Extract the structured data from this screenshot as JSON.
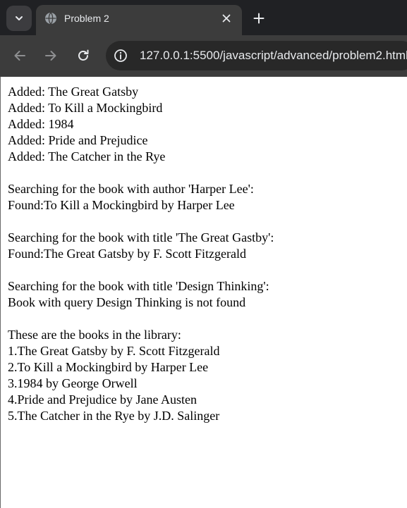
{
  "browser": {
    "tab_title": "Problem 2",
    "url": "127.0.0.1:5500/javascript/advanced/problem2.html",
    "icons": {
      "tab_search": "chevron-down-icon",
      "favicon": "globe-icon",
      "tab_close": "close-icon",
      "new_tab": "plus-icon",
      "back": "arrow-left-icon",
      "forward": "arrow-right-icon",
      "reload": "reload-icon",
      "site_info": "info-icon"
    },
    "colors": {
      "tabstrip_bg": "#202124",
      "toolbar_bg": "#3c3c3c",
      "omnibox_bg": "#282828",
      "text_light": "#e8eaed"
    }
  },
  "page": {
    "added": [
      "Added: The Great Gatsby",
      "Added: To Kill a Mockingbird",
      "Added: 1984",
      "Added: Pride and Prejudice",
      "Added: The Catcher in the Rye"
    ],
    "search_author": {
      "heading": "Searching for the book with author 'Harper Lee':",
      "result": "Found:To Kill a Mockingbird by Harper Lee"
    },
    "search_title": {
      "heading": "Searching for the book with title 'The Great Gastby':",
      "result": "Found:The Great Gatsby by F. Scott Fitzgerald"
    },
    "search_missing": {
      "heading": "Searching for the book with title 'Design Thinking':",
      "result": "Book with query Design Thinking is not found"
    },
    "library": {
      "heading": "These are the books in the library:",
      "books": [
        "1.The Great Gatsby by F. Scott Fitzgerald",
        "2.To Kill a Mockingbird by Harper Lee",
        "3.1984 by George Orwell",
        "4.Pride and Prejudice by Jane Austen",
        "5.The Catcher in the Rye by J.D. Salinger"
      ]
    }
  }
}
